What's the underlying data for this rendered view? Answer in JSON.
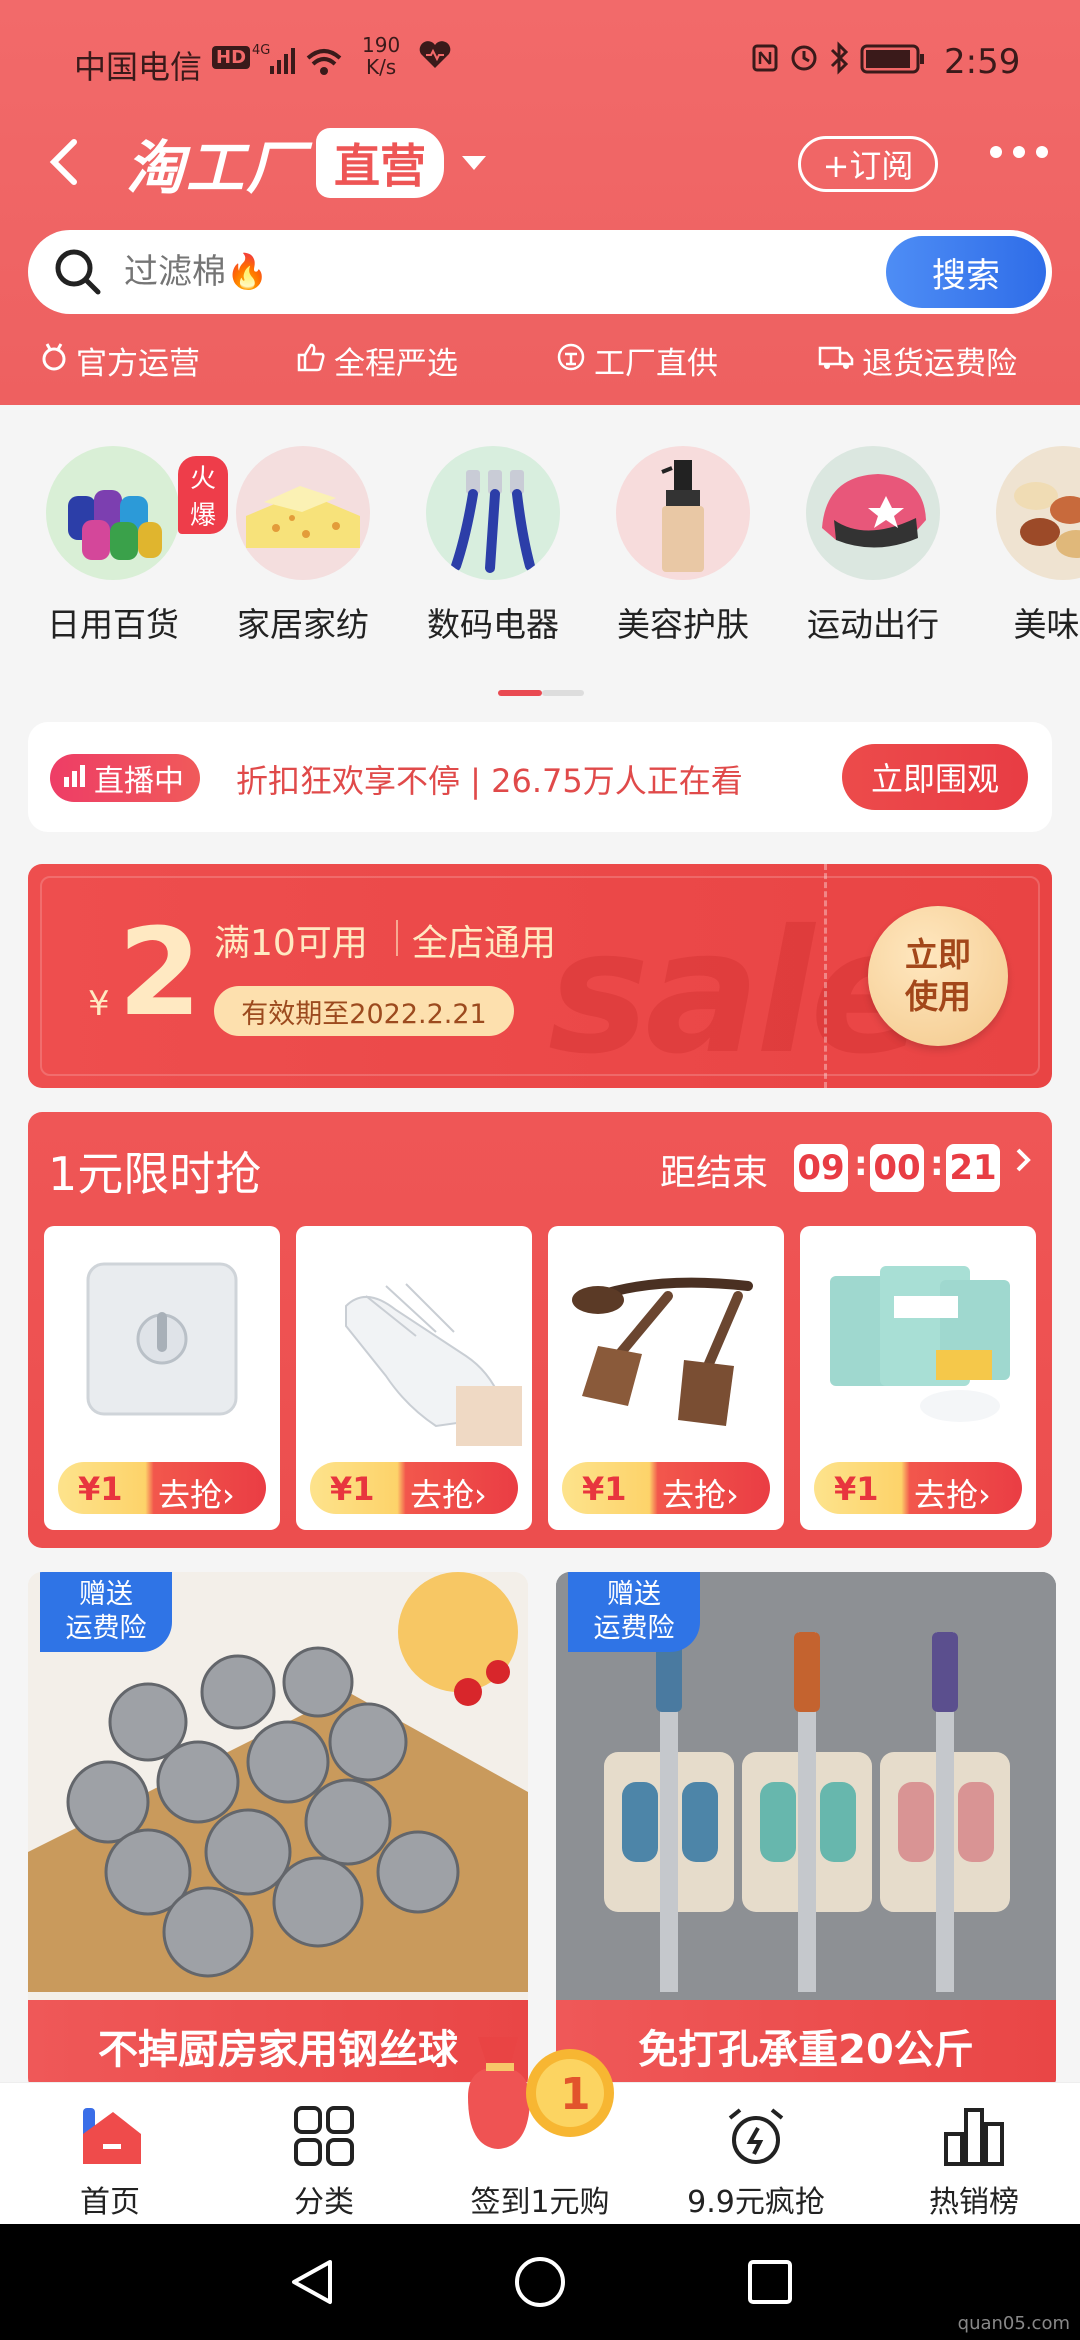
{
  "status_bar": {
    "carrier": "中国电信",
    "hd": "HD",
    "network": "4G",
    "speed_top": "190",
    "speed_unit": "K/s",
    "time": "2:59"
  },
  "nav": {
    "logo_main": "淘工厂",
    "logo_tag": "直营",
    "subscribe": "+订阅"
  },
  "search": {
    "placeholder": "过滤棉🔥",
    "button": "搜索"
  },
  "features": [
    {
      "icon": "medal-icon",
      "label": "官方运营"
    },
    {
      "icon": "thumb-up-icon",
      "label": "全程严选"
    },
    {
      "icon": "factory-icon",
      "label": "工厂直供"
    },
    {
      "icon": "truck-icon",
      "label": "退货运费险"
    }
  ],
  "categories": [
    {
      "label": "日用百货",
      "badge": "火爆"
    },
    {
      "label": "家居家纺"
    },
    {
      "label": "数码电器"
    },
    {
      "label": "美容护肤"
    },
    {
      "label": "运动出行"
    },
    {
      "label": "美味食"
    }
  ],
  "live": {
    "badge": "直播中",
    "text": "折扣狂欢享不停 | 26.75万人正在看",
    "button": "立即围观"
  },
  "coupon": {
    "currency": "¥",
    "amount": "2",
    "condition": "满10可用",
    "scope": "全店通用",
    "validity": "有效期至2022.2.21",
    "use_line1": "立即",
    "use_line2": "使用",
    "watermark": "sale"
  },
  "flash_sale": {
    "title": "1元限时抢",
    "ends_label": "距结束",
    "hours": "09",
    "minutes": "00",
    "seconds": "21",
    "products": [
      {
        "price": "¥1",
        "action": "去抢›"
      },
      {
        "price": "¥1",
        "action": "去抢›"
      },
      {
        "price": "¥1",
        "action": "去抢›"
      },
      {
        "price": "¥1",
        "action": "去抢›"
      }
    ]
  },
  "tiles": [
    {
      "badge_line1": "赠送",
      "badge_line2": "运费险",
      "title": "不掉厨房家用钢丝球"
    },
    {
      "badge_line1": "赠送",
      "badge_line2": "运费险",
      "title": "免打孔承重20公斤"
    }
  ],
  "tabbar": [
    {
      "label": "首页",
      "active": true
    },
    {
      "label": "分类"
    },
    {
      "label": "签到1元购"
    },
    {
      "label": "9.9元疯抢"
    },
    {
      "label": "热销榜"
    }
  ],
  "watermark": "quan05.com",
  "colors": {
    "brand_red": "#ee5555",
    "search_blue": "#2f6de8",
    "cream": "#ffe9c2"
  }
}
